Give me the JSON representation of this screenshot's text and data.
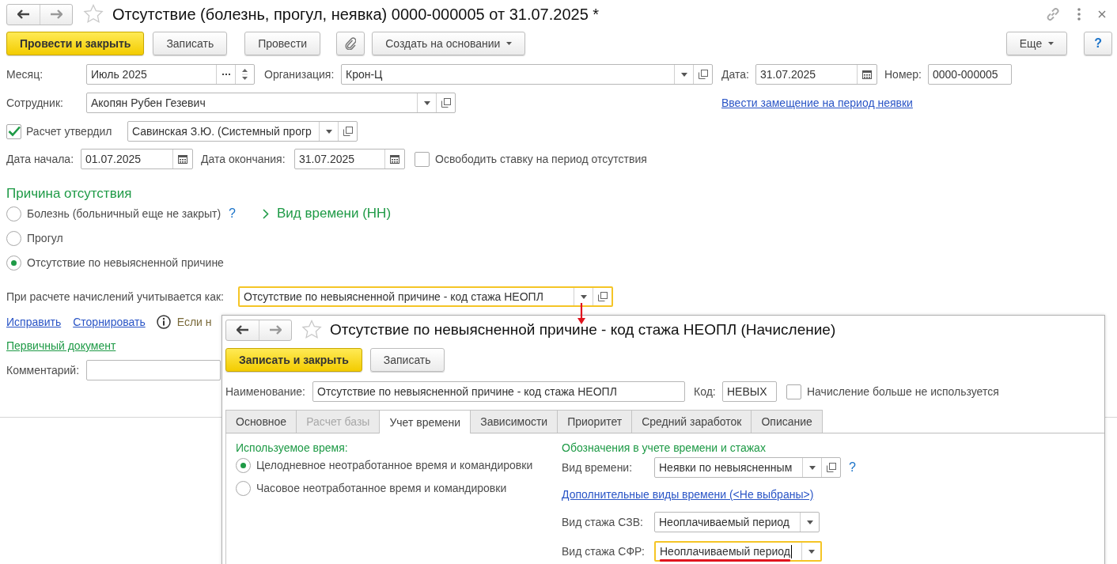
{
  "window": {
    "title": "Отсутствие (болезнь, прогул, неявка) 0000-000005 от 31.07.2025 *",
    "favorite": false
  },
  "toolbar": {
    "buttons": [
      {
        "label": "Провести и закрыть",
        "kind": "primary"
      },
      {
        "label": "Записать",
        "kind": "plain"
      },
      {
        "label": "Провести",
        "kind": "plain"
      },
      {
        "kind": "attach"
      },
      {
        "label": "Создать на основании",
        "kind": "menu"
      }
    ],
    "right": [
      {
        "label": "Еще",
        "kind": "menu"
      },
      {
        "label": "?",
        "kind": "help"
      }
    ]
  },
  "header": {
    "month": {
      "label": "Месяц:",
      "value": "Июль 2025",
      "kind": "period"
    },
    "organization": {
      "label": "Организация:",
      "value": "Крон-Ц",
      "kind": "combo"
    },
    "date": {
      "label": "Дата:",
      "value": "31.07.2025",
      "kind": "date"
    },
    "number": {
      "label": "Номер:",
      "value": "0000-000005"
    },
    "employee": {
      "label": "Сотрудник:",
      "value": "Акопян Рубен Гезевич",
      "kind": "combo"
    },
    "substitution_link": "Ввести замещение на период неявки",
    "approved": {
      "label": "Расчет утвердил",
      "checked": true,
      "value": "Савинская З.Ю. (Системный прогр",
      "kind": "combo"
    },
    "start": {
      "label": "Дата начала:",
      "value": "01.07.2025",
      "kind": "date"
    },
    "end": {
      "label": "Дата окончания:",
      "value": "31.07.2025",
      "kind": "date"
    },
    "free_rate": {
      "label": "Освободить ставку на период отсутствия",
      "checked": false
    }
  },
  "reason": {
    "title": "Причина отсутствия",
    "options": [
      {
        "label": "Болезнь (больничный еще не закрыт)",
        "selected": false,
        "help": "?"
      },
      {
        "label": "Прогул",
        "selected": false
      },
      {
        "label": "Отсутствие по невыясненной причине",
        "selected": true
      }
    ],
    "time_kind_link": "Вид времени (НН)"
  },
  "accrual": {
    "label": "При расчете начислений учитывается как:",
    "value": "Отсутствие по невыясненной причине - код стажа НЕОПЛ",
    "kind": "combo",
    "focused": true,
    "arrow": true
  },
  "actions": {
    "links": [
      "Исправить",
      "Сторнировать"
    ],
    "note": "Если н"
  },
  "primary_document_link": "Первичный документ",
  "comment": {
    "label": "Комментарий:"
  },
  "popup": {
    "title": "Отсутствие по невыясненной причине - код стажа НЕОПЛ (Начисление)",
    "favorite": false,
    "buttons": [
      {
        "label": "Записать и закрыть",
        "kind": "primary"
      },
      {
        "label": "Записать",
        "kind": "plain"
      }
    ],
    "name_field": {
      "label": "Наименование:",
      "value": "Отсутствие по невыясненной причине - код стажа НЕОПЛ"
    },
    "code_field": {
      "label": "Код:",
      "value": "НЕВЫХ"
    },
    "unused": {
      "label": "Начисление больше не используется",
      "checked": false
    },
    "tabs": [
      {
        "label": "Основное",
        "selected": false,
        "disabled": false
      },
      {
        "label": "Расчет базы",
        "selected": false,
        "disabled": true
      },
      {
        "label": "Учет времени",
        "selected": true,
        "disabled": false
      },
      {
        "label": "Зависимости",
        "selected": false,
        "disabled": false
      },
      {
        "label": "Приоритет",
        "selected": false,
        "disabled": false
      },
      {
        "label": "Средний заработок",
        "selected": false,
        "disabled": false
      },
      {
        "label": "Описание",
        "selected": false,
        "disabled": false
      }
    ],
    "used_time": {
      "title": "Используемое время:",
      "options": [
        {
          "label": "Целодневное неотработанное время и командировки",
          "selected": true
        },
        {
          "label": "Часовое неотработанное время и командировки",
          "selected": false
        }
      ]
    },
    "designations": {
      "title": "Обозначения в учете времени и стажах",
      "time_kind": {
        "label": "Вид времени:",
        "value": "Неявки по невыясненным",
        "kind": "combo",
        "help": "?"
      },
      "extra_link": "Дополнительные виды времени (<Не выбраны>)",
      "szv": {
        "label": "Вид стажа СЗВ:",
        "value": "Неоплачиваемый период",
        "kind": "select"
      },
      "sfr": {
        "label": "Вид стажа СФР:",
        "value": "Неоплачиваемый период",
        "kind": "select",
        "focused": true,
        "underlined": true,
        "cursor": true
      }
    }
  }
}
